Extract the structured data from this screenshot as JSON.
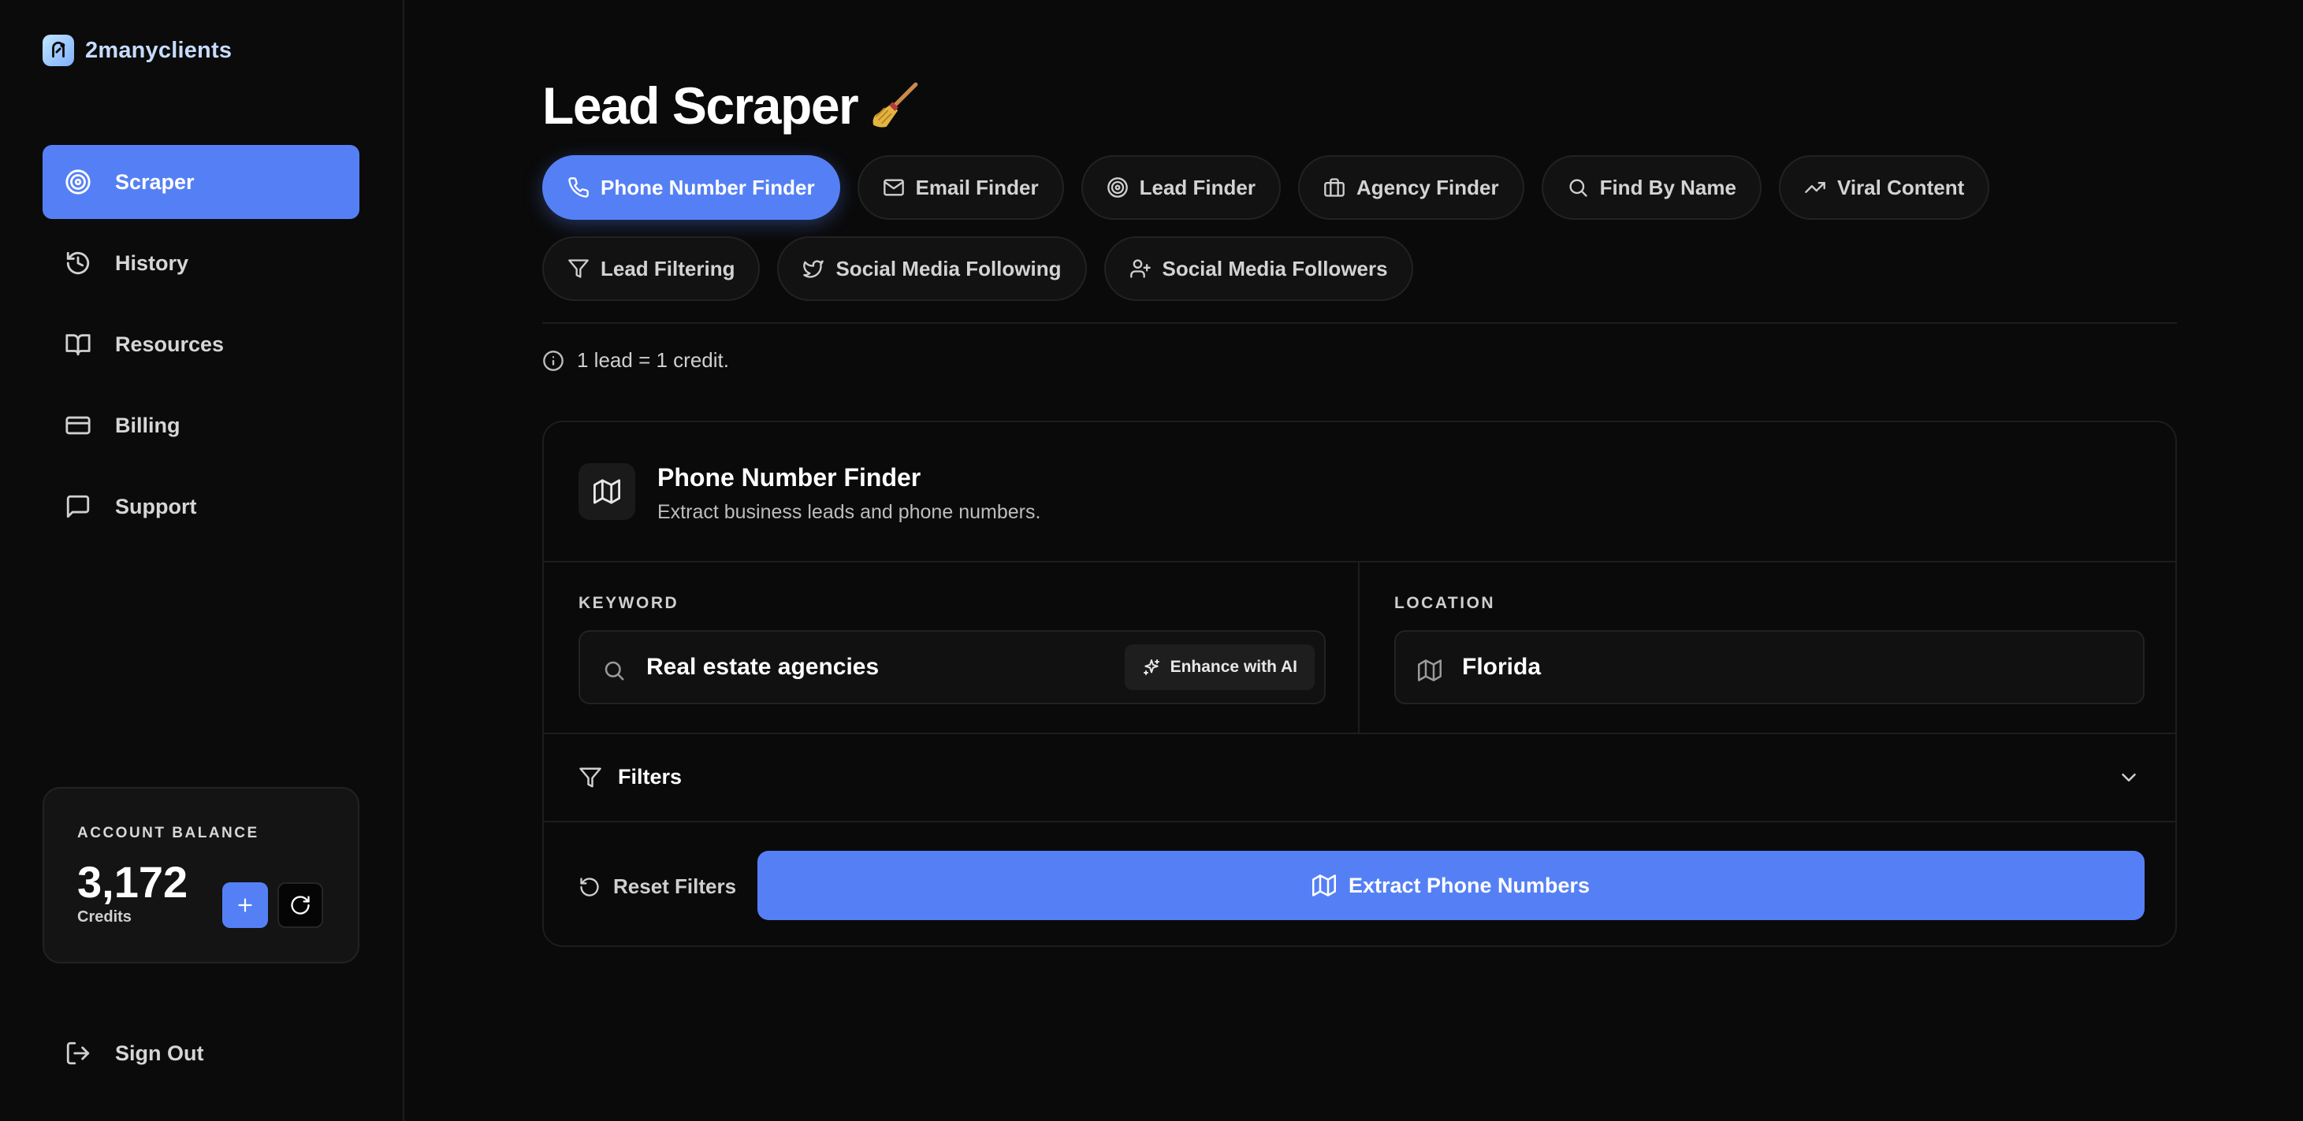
{
  "app": {
    "brand": "2manyclients"
  },
  "sidebar": {
    "items": [
      {
        "label": "Scraper",
        "icon": "target-icon",
        "active": true
      },
      {
        "label": "History",
        "icon": "history-icon",
        "active": false
      },
      {
        "label": "Resources",
        "icon": "book-icon",
        "active": false
      },
      {
        "label": "Billing",
        "icon": "credit-card-icon",
        "active": false
      },
      {
        "label": "Support",
        "icon": "message-icon",
        "active": false
      }
    ],
    "balance": {
      "label": "ACCOUNT BALANCE",
      "value": "3,172",
      "unit": "Credits"
    },
    "signout_label": "Sign Out"
  },
  "page": {
    "title": "Lead Scraper",
    "title_emoji": "broom-icon"
  },
  "tabs": [
    {
      "label": "Phone Number Finder",
      "icon": "phone-icon",
      "active": true
    },
    {
      "label": "Email Finder",
      "icon": "mail-icon",
      "active": false
    },
    {
      "label": "Lead Finder",
      "icon": "target-icon",
      "active": false
    },
    {
      "label": "Agency Finder",
      "icon": "briefcase-icon",
      "active": false
    },
    {
      "label": "Find By Name",
      "icon": "search-icon",
      "active": false
    },
    {
      "label": "Viral Content",
      "icon": "trending-up-icon",
      "active": false
    },
    {
      "label": "Lead Filtering",
      "icon": "filter-icon",
      "active": false
    },
    {
      "label": "Social Media Following",
      "icon": "twitter-icon",
      "active": false
    },
    {
      "label": "Social Media Followers",
      "icon": "user-plus-icon",
      "active": false
    }
  ],
  "credit_note": "1 lead = 1 credit.",
  "card": {
    "title": "Phone Number Finder",
    "subtitle": "Extract business leads and phone numbers.",
    "keyword": {
      "label": "KEYWORD",
      "value": "Real estate agencies",
      "enhance_label": "Enhance with AI"
    },
    "location": {
      "label": "LOCATION",
      "value": "Florida"
    },
    "filters_label": "Filters",
    "reset_label": "Reset Filters",
    "extract_label": "Extract Phone Numbers"
  },
  "colors": {
    "accent": "#5580f5",
    "background": "#0a0a0a",
    "surface": "#121212"
  }
}
